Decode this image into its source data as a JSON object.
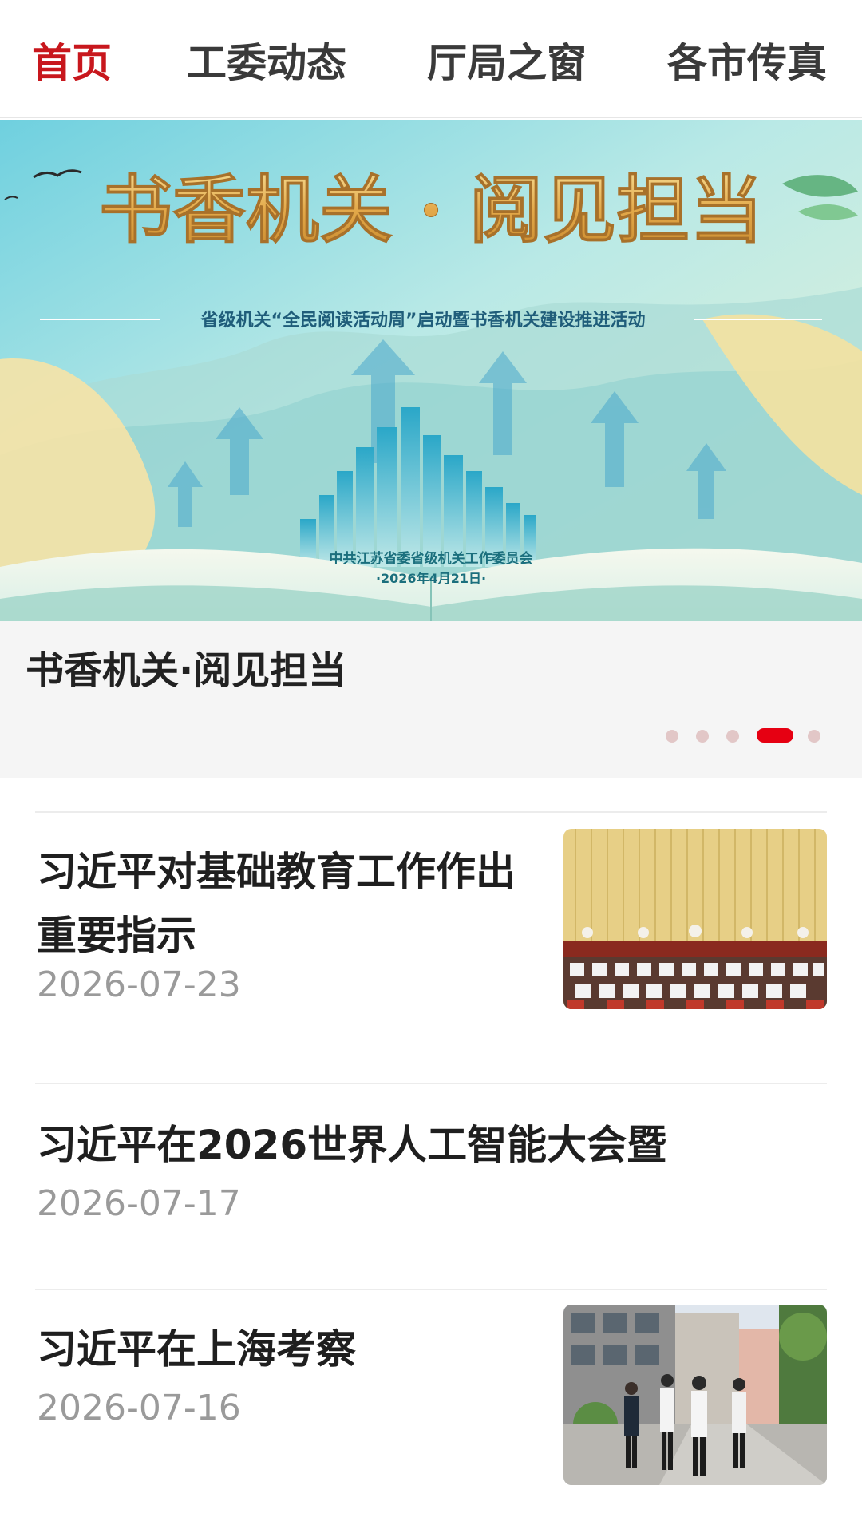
{
  "tabs": [
    {
      "label": "首页",
      "active": true
    },
    {
      "label": "工委动态",
      "active": false
    },
    {
      "label": "厅局之窗",
      "active": false
    },
    {
      "label": "各市传真",
      "active": false
    }
  ],
  "banner": {
    "headline": "书香机关 · 阅见担当",
    "subtitle": "省级机关“全民阅读活动周”启动暨书香机关建设推进活动",
    "org": "中共江苏省委省级机关工作委员会",
    "date": "·2026年4月21日·"
  },
  "carousel": {
    "caption": "书香机关·阅见担当",
    "dot_count": 5,
    "active_index": 3
  },
  "news": [
    {
      "title": "习近平对基础教育工作作出重要指示",
      "date": "2026-07-23",
      "has_thumb": true,
      "thumb": "meeting-photo"
    },
    {
      "title": "习近平在2026世界人工智能大会暨",
      "date": "2026-07-17",
      "has_thumb": false
    },
    {
      "title": "习近平在上海考察",
      "date": "2026-07-16",
      "has_thumb": true,
      "thumb": "street-inspection-photo"
    }
  ],
  "colors": {
    "accent": "#c8171d",
    "dot_active": "#e60012",
    "dot_inactive": "#e2c7c7",
    "date_gray": "#9a9a9a"
  }
}
